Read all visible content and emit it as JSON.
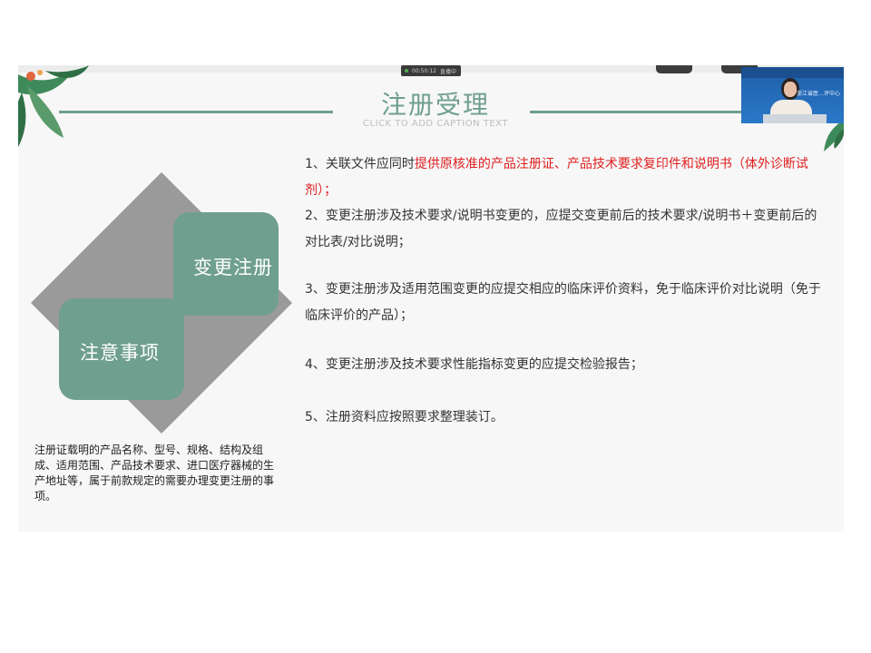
{
  "meeting_bar": {
    "timer": "00:50:12",
    "status": "直播中"
  },
  "slide": {
    "title": "注册受理",
    "caption": "CLICK TO ADD CAPTION TEXT",
    "diagram": {
      "box_top": "变更注册",
      "box_bottom": "注意事项"
    },
    "note": "注册证载明的产品名称、型号、规格、结构及组成、适用范围、产品技术要求、进口医疗器械的生产地址等，属于前款规定的需要办理变更注册的事项。",
    "items": [
      {
        "before": "1、关联文件应同时",
        "highlight": "提供原核准的产品注册证、产品技术要求复印件和说明书（体外诊断试剂）；",
        "after": ""
      },
      {
        "before": "2、变更注册涉及技术要求/说明书变更的，应提交变更前后的技术要求/说明书＋变更前后的对比表/对比说明；",
        "highlight": "",
        "after": ""
      },
      {
        "before": "3、变更注册涉及适用范围变更的应提交相应的临床评价资料，免于临床评价对比说明（免于临床评价的产品）；",
        "highlight": "",
        "after": ""
      },
      {
        "before": "4、变更注册涉及技术要求性能指标变更的应提交检验报告；",
        "highlight": "",
        "after": ""
      },
      {
        "before": "5、注册资料应按照要求整理装订。",
        "highlight": "",
        "after": ""
      }
    ]
  },
  "video_overlay": {
    "label": "浙江省医…评中心"
  },
  "colors": {
    "accent": "#6f9f8f",
    "highlight": "#e02020",
    "diamond": "#9a9a9a"
  }
}
